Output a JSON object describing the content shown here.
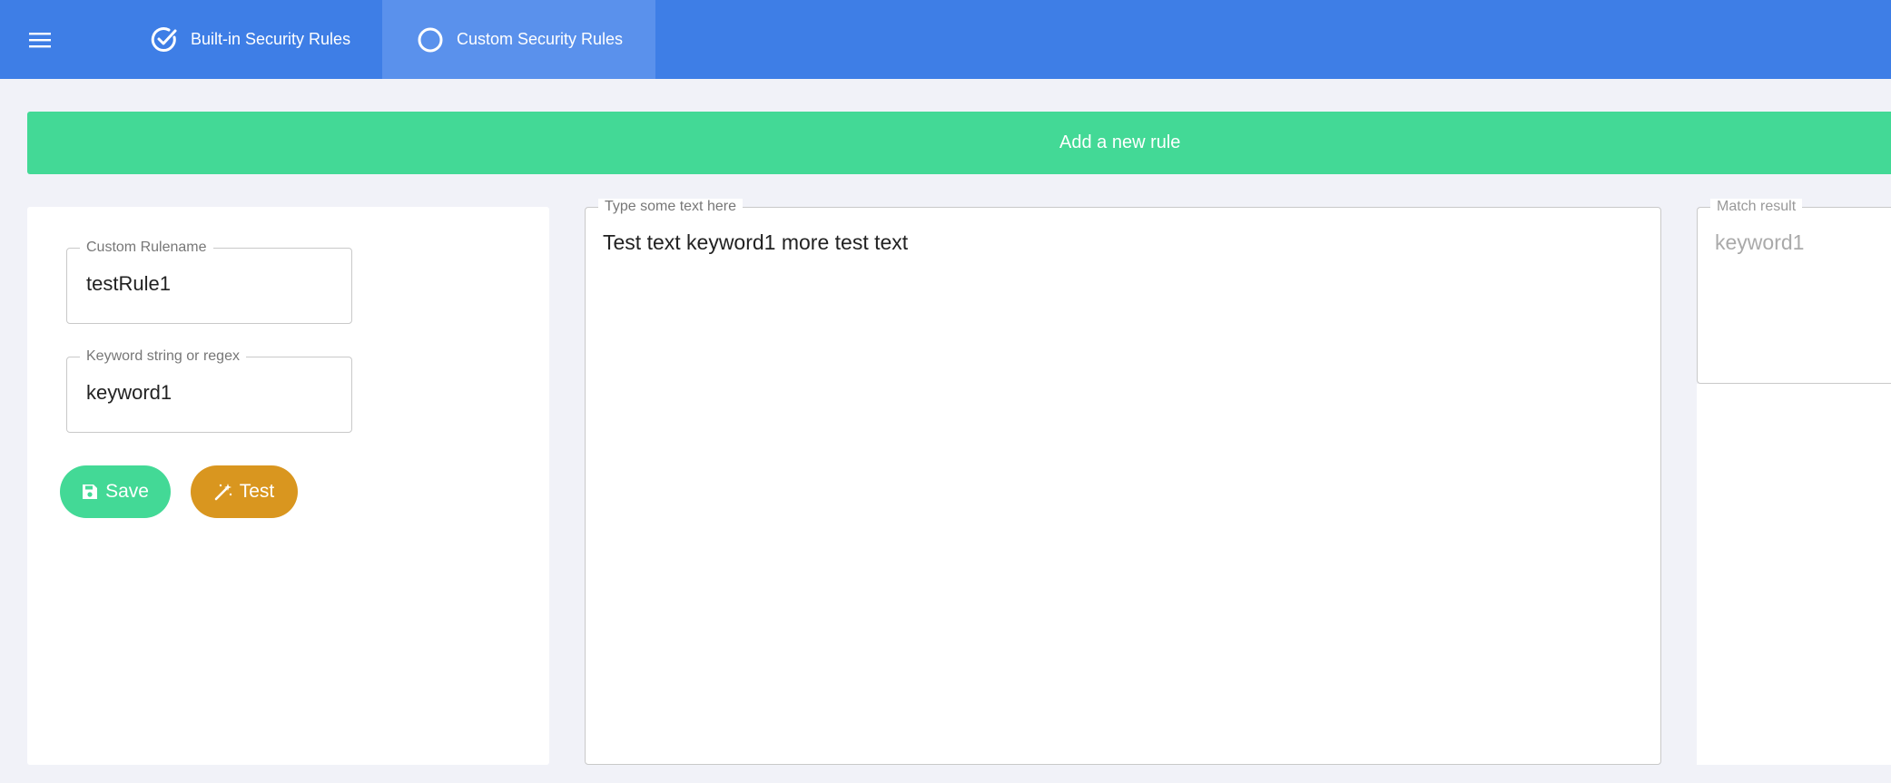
{
  "header": {
    "menu_icon": "hamburger-menu-icon",
    "tabs": [
      {
        "label": "Built-in Security Rules",
        "icon": "check-circle-icon",
        "active": false
      },
      {
        "label": "Custom Security Rules",
        "icon": "circle-icon",
        "active": true
      }
    ]
  },
  "add_rule": {
    "label": "Add a new rule"
  },
  "rule_form": {
    "rulename": {
      "legend": "Custom Rulename",
      "value": "testRule1"
    },
    "keyword": {
      "legend": "Keyword string or regex",
      "value": "keyword1"
    },
    "save_label": "Save",
    "test_label": "Test"
  },
  "test_text": {
    "legend": "Type some text here",
    "value": "Test text keyword1 more test text"
  },
  "match_result": {
    "legend": "Match result",
    "value": "keyword1"
  },
  "colors": {
    "topbar": "#3e7ee6",
    "active_tab": "#5a91ec",
    "green": "#43d996",
    "orange": "#d9961f",
    "background": "#f1f2f8"
  }
}
